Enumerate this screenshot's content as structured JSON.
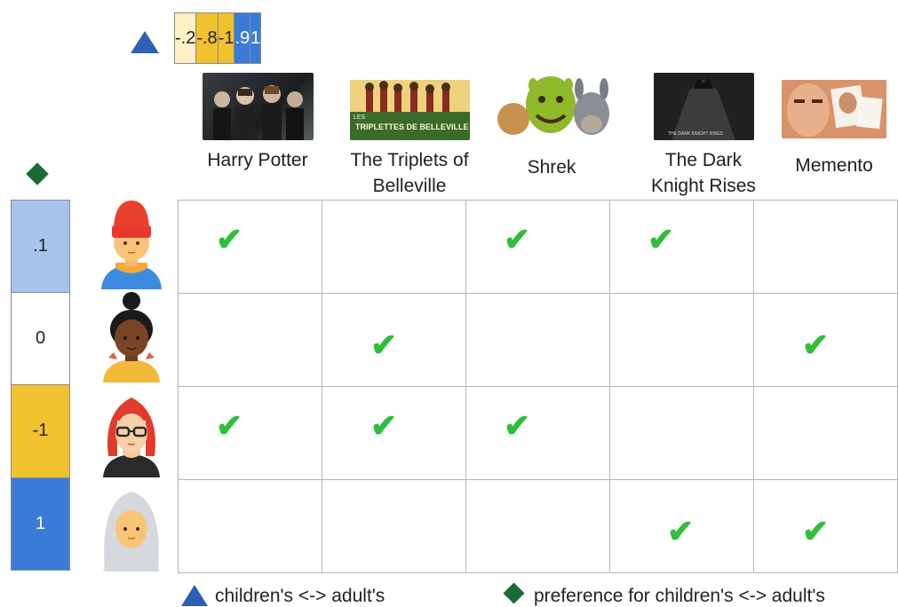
{
  "top_scores": [
    {
      "label": "-.2",
      "color": "#fdf0c4",
      "text_color": "#222222"
    },
    {
      "label": "-.8",
      "color": "#f2c12e",
      "text_color": "#222222"
    },
    {
      "label": "-1",
      "color": "#f2c12e",
      "text_color": "#222222"
    },
    {
      "label": ".9",
      "color": "#3b7bd8",
      "text_color": "#ffffff"
    },
    {
      "label": "1",
      "color": "#3b7bd8",
      "text_color": "#ffffff"
    }
  ],
  "movies": [
    {
      "title": "Harry Potter",
      "poster_icon": "harry-potter-poster"
    },
    {
      "title": "The Triplets of Belleville",
      "poster_icon": "triplets-poster",
      "poster_text_1": "LES",
      "poster_text_2": "TRIPLETTES DE BELLEVILLE"
    },
    {
      "title": "Shrek",
      "poster_icon": "shrek-poster"
    },
    {
      "title": "The Dark Knight Rises",
      "poster_icon": "dark-knight-poster",
      "poster_text": "THE DARK KNIGHT RISES"
    },
    {
      "title": "Memento",
      "poster_icon": "memento-poster"
    }
  ],
  "user_scores": [
    {
      "label": ".1",
      "color": "#a7c4ef",
      "text_color": "#222222"
    },
    {
      "label": "0",
      "color": "#ffffff",
      "text_color": "#222222"
    },
    {
      "label": "-1",
      "color": "#f2c12e",
      "text_color": "#222222"
    },
    {
      "label": "1",
      "color": "#3b7bd8",
      "text_color": "#ffffff"
    }
  ],
  "users": [
    {
      "avatar": "red-hat-avatar"
    },
    {
      "avatar": "dark-bun-avatar"
    },
    {
      "avatar": "red-hair-glasses-avatar"
    },
    {
      "avatar": "gray-hair-avatar"
    }
  ],
  "ratings": [
    [
      1,
      0,
      1,
      1,
      0
    ],
    [
      0,
      1,
      0,
      0,
      1
    ],
    [
      1,
      1,
      1,
      0,
      0
    ],
    [
      0,
      0,
      0,
      1,
      1
    ]
  ],
  "check_glyph": "✔",
  "legend": {
    "triangle_text": "children's <-> adult's",
    "diamond_text": "preference for children's <-> adult's"
  }
}
